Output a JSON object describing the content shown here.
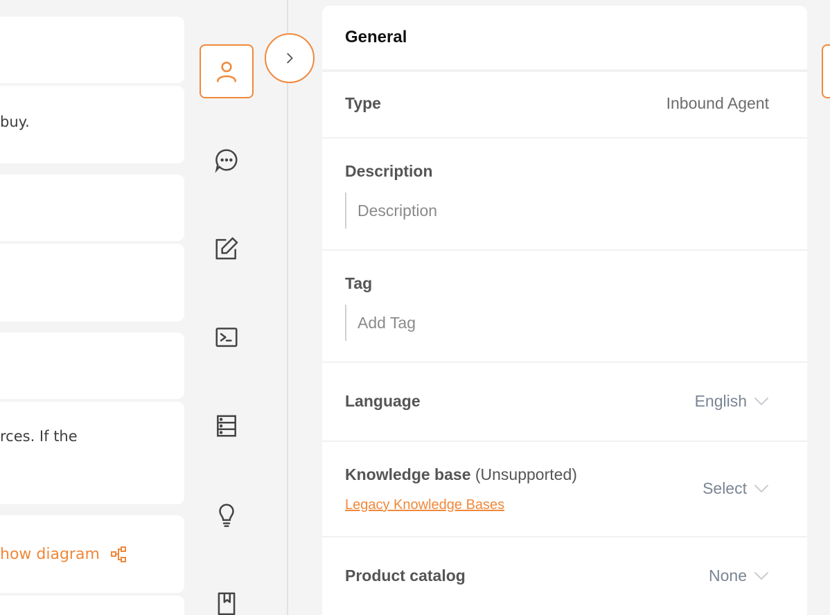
{
  "left_cards": {
    "text_buy": "buy.",
    "text_sources": "rces. If the",
    "show_diagram": "how diagram"
  },
  "general": {
    "title": "General",
    "type_label": "Type",
    "type_value": "Inbound Agent",
    "description_label": "Description",
    "description_placeholder": "Description",
    "tag_label": "Tag",
    "tag_placeholder": "Add Tag",
    "language_label": "Language",
    "language_value": "English",
    "kb_label": "Knowledge base",
    "kb_suffix": "(Unsupported)",
    "kb_link": "Legacy Knowledge Bases",
    "kb_value": "Select",
    "catalog_label": "Product catalog",
    "catalog_value": "None"
  },
  "icons": {
    "rail": [
      "user-icon",
      "chat-bubble-icon",
      "edit-icon",
      "terminal-icon",
      "server-icon",
      "lightbulb-icon",
      "book-icon"
    ],
    "toggle": "chevron-right-icon"
  },
  "colors": {
    "accent": "#f0883a",
    "background": "#f4f4f5"
  }
}
